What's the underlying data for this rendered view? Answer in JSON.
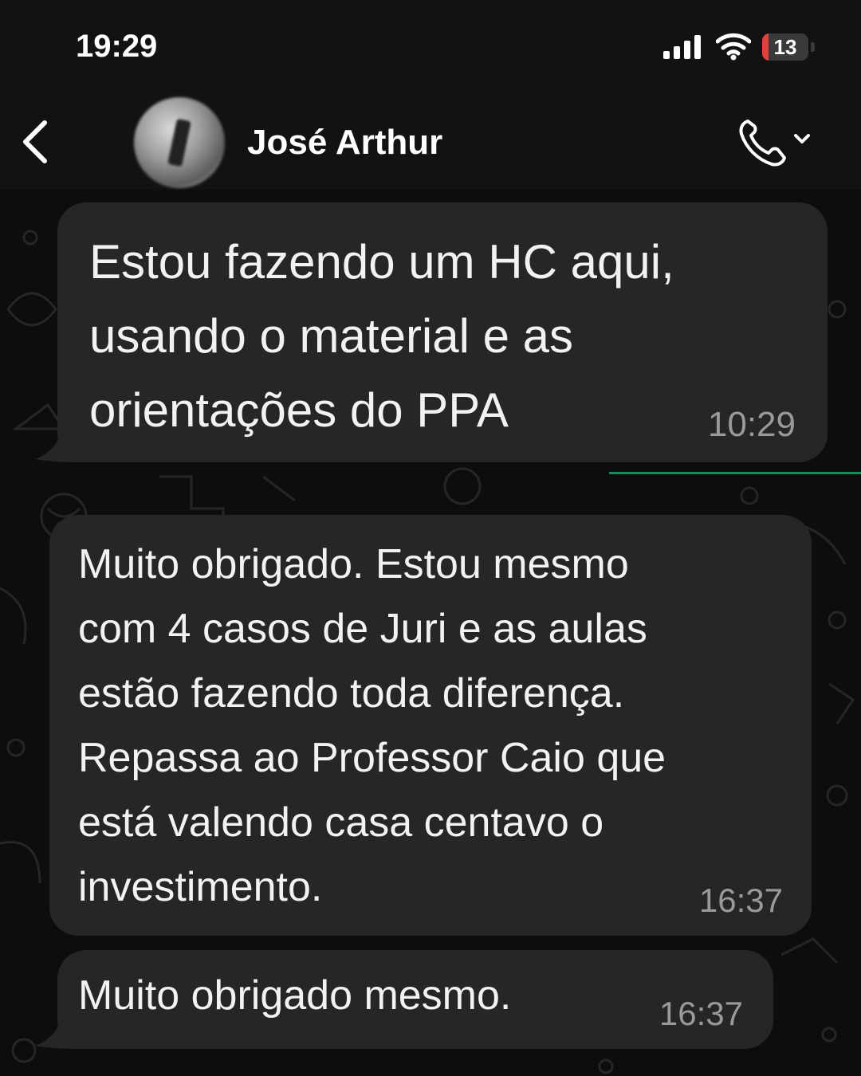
{
  "status_bar": {
    "time": "19:29",
    "battery_level": "13",
    "battery_fraction": 0.13,
    "icons": [
      "signal-icon",
      "wifi-icon",
      "battery-icon"
    ]
  },
  "header": {
    "contact_name": "José Arthur",
    "icons": [
      "chevron-left-icon",
      "phone-icon",
      "chevron-down-icon"
    ]
  },
  "messages": [
    {
      "text": "Estou fazendo um HC aqui,\nusando o material e as\norientações do PPA",
      "time": "10:29"
    },
    {
      "text": "Muito obrigado. Estou mesmo\ncom 4 casos de Juri e as aulas\nestão fazendo toda diferença.\nRepassa ao Professor Caio que\nestá valendo casa centavo o\ninvestimento.",
      "time": "16:37"
    },
    {
      "text": "Muito obrigado mesmo.",
      "time": "16:37"
    }
  ],
  "colors": {
    "background": "#0b0b0b",
    "bubble": "#262626",
    "timestamp": "#9a9a9a",
    "battery_low": "#e0413a",
    "unread_line": "#1b8a5c"
  }
}
